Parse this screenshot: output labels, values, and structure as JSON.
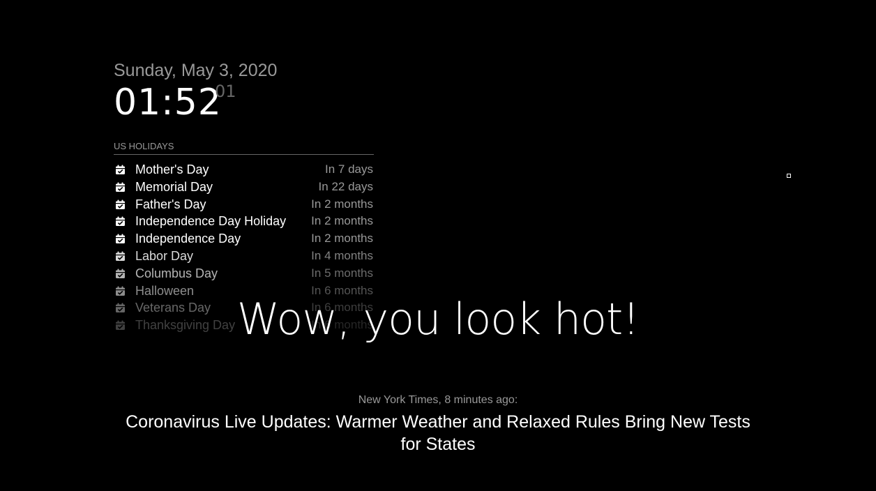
{
  "clock": {
    "date": "Sunday, May 3, 2020",
    "time": "01:52",
    "seconds": "01"
  },
  "calendar": {
    "header": "US HOLIDAYS",
    "icon": "calendar-check-icon",
    "events": [
      {
        "title": "Mother's Day",
        "when": "In 7 days"
      },
      {
        "title": "Memorial Day",
        "when": "In 22 days"
      },
      {
        "title": "Father's Day",
        "when": "In 2 months"
      },
      {
        "title": "Independence Day Holiday",
        "when": "In 2 months"
      },
      {
        "title": "Independence Day",
        "when": "In 2 months"
      },
      {
        "title": "Labor Day",
        "when": "In 4 months"
      },
      {
        "title": "Columbus Day",
        "when": "In 5 months"
      },
      {
        "title": "Halloween",
        "when": "In 6 months"
      },
      {
        "title": "Veterans Day",
        "when": "In 6 months"
      },
      {
        "title": "Thanksgiving Day",
        "when": "In 6 months"
      }
    ]
  },
  "compliment": "Wow, you look hot!",
  "newsfeed": {
    "source": "New York Times, 8 minutes ago:",
    "headline": "Coronavirus Live Updates: Warmer Weather and Relaxed Rules Bring New Tests for States"
  }
}
